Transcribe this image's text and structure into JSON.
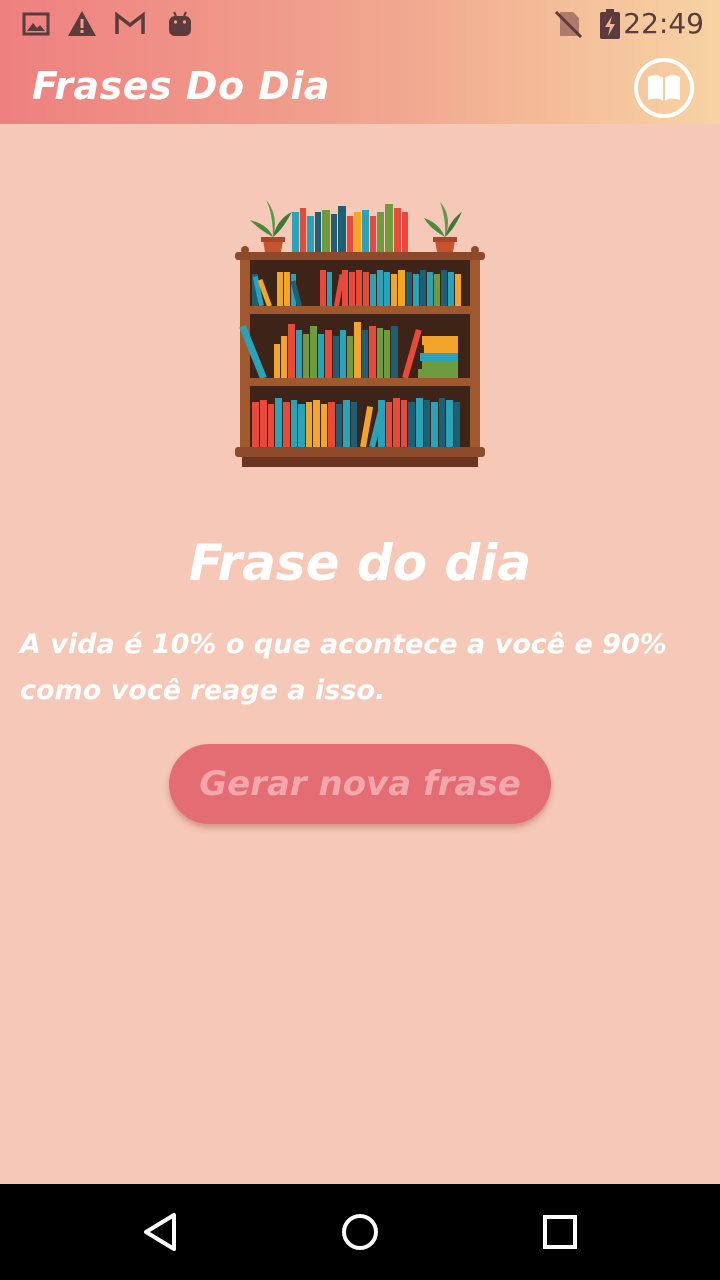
{
  "status_bar": {
    "time": "22:49",
    "left_icons": [
      "image-icon",
      "warning-icon",
      "gmail-icon",
      "android-icon"
    ],
    "right_icons": [
      "no-sim-icon",
      "battery-charging-icon"
    ]
  },
  "app_bar": {
    "title": "Frases Do Dia",
    "action_icon": "book-icon"
  },
  "main": {
    "illustration": "bookshelf-illustration",
    "heading": "Frase do dia",
    "quote": "A vida é 10% o que acontece a você e 90% como você reage a isso.",
    "button_label": "Gerar nova frase"
  },
  "nav_bar": {
    "buttons": [
      "back-icon",
      "home-icon",
      "recents-icon"
    ]
  },
  "colors": {
    "background": "#f5c8b8",
    "app_bar_gradient_start": "#ee8080",
    "app_bar_gradient_end": "#f7d3a3",
    "button": "#e46c73",
    "button_text": "#f4a6ad"
  }
}
